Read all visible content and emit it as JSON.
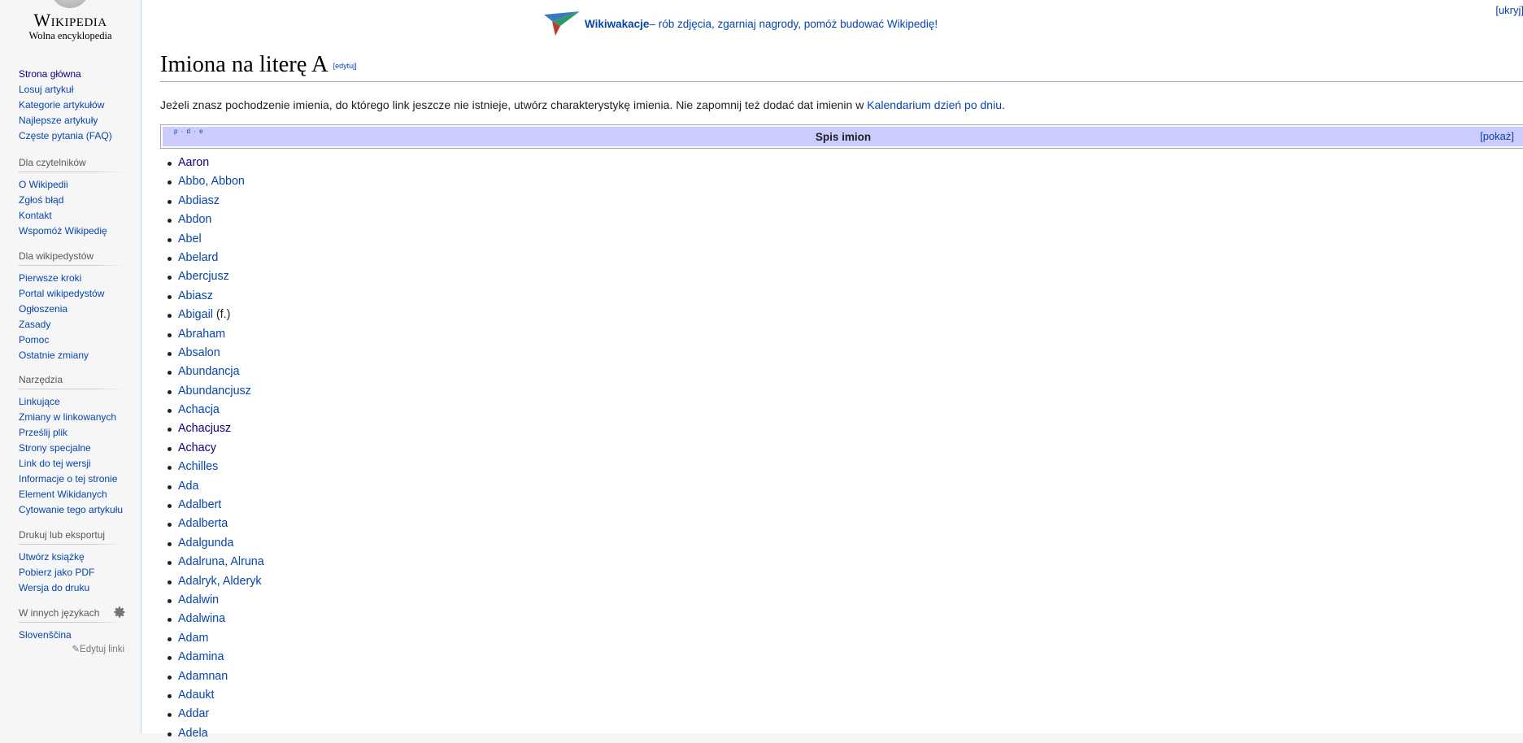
{
  "logo": {
    "wordmark": "Wikipedia",
    "tagline": "Wolna encyklopedia"
  },
  "sidebar": {
    "main_links": [
      "Strona główna",
      "Losuj artykuł",
      "Kategorie artykułów",
      "Najlepsze artykuły",
      "Częste pytania (FAQ)"
    ],
    "readers": {
      "heading": "Dla czytelników",
      "links": [
        "O Wikipedii",
        "Zgłoś błąd",
        "Kontakt",
        "Wspomóż Wikipedię"
      ]
    },
    "editors": {
      "heading": "Dla wikipedystów",
      "links": [
        "Pierwsze kroki",
        "Portal wikipedystów",
        "Ogłoszenia",
        "Zasady",
        "Pomoc",
        "Ostatnie zmiany"
      ]
    },
    "tools": {
      "heading": "Narzędzia",
      "links": [
        "Linkujące",
        "Zmiany w linkowanych",
        "Prześlij plik",
        "Strony specjalne",
        "Link do tej wersji",
        "Informacje o tej stronie",
        "Element Wikidanych",
        "Cytowanie tego artykułu"
      ]
    },
    "print": {
      "heading": "Drukuj lub eksportuj",
      "links": [
        "Utwórz książkę",
        "Pobierz jako PDF",
        "Wersja do druku"
      ]
    },
    "languages": {
      "heading": "W innych językach",
      "links": [
        "Slovenščina"
      ],
      "edit_links": "Edytuj linki",
      "settings_icon": "gear-icon"
    }
  },
  "sitenotice": {
    "icon": "paper-plane-icon",
    "strong": "Wikiwakacje",
    "text": " – rób zdjęcia, zgarniaj nagrody, pomóż budować Wikipedię!",
    "hide": "[ukryj]"
  },
  "page": {
    "title": "Imiona na literę A",
    "edit_section": "[edytuj]",
    "intro_text": "Jeżeli znasz pochodzenie imienia, do którego link jeszcze nie istnieje, utwórz charakterystykę imienia. Nie zapomnij też dodać dat imienin w ",
    "intro_link": "Kalendarium dzień po dniu",
    "intro_end": "."
  },
  "navbox": {
    "vde": "p · d · e",
    "title": "Spis imion",
    "toggle": "[pokaż]"
  },
  "names": [
    {
      "name": "Aaron",
      "visited": true
    },
    {
      "name": "Abbo, Abbon"
    },
    {
      "name": "Abdiasz"
    },
    {
      "name": "Abdon"
    },
    {
      "name": "Abel"
    },
    {
      "name": "Abelard"
    },
    {
      "name": "Abercjusz"
    },
    {
      "name": "Abiasz"
    },
    {
      "name": "Abigail",
      "note": " (f.)"
    },
    {
      "name": "Abraham"
    },
    {
      "name": "Absalon"
    },
    {
      "name": "Abundancja"
    },
    {
      "name": "Abundancjusz"
    },
    {
      "name": "Achacja"
    },
    {
      "name": "Achacjusz",
      "visited": true
    },
    {
      "name": "Achacy",
      "visited": true
    },
    {
      "name": "Achilles"
    },
    {
      "name": "Ada"
    },
    {
      "name": "Adalbert"
    },
    {
      "name": "Adalberta"
    },
    {
      "name": "Adalgunda"
    },
    {
      "name": "Adalruna, Alruna"
    },
    {
      "name": "Adalryk, Alderyk"
    },
    {
      "name": "Adalwin"
    },
    {
      "name": "Adalwina"
    },
    {
      "name": "Adam"
    },
    {
      "name": "Adamina"
    },
    {
      "name": "Adamnan"
    },
    {
      "name": "Adaukt"
    },
    {
      "name": "Addar"
    },
    {
      "name": "Adela"
    }
  ]
}
